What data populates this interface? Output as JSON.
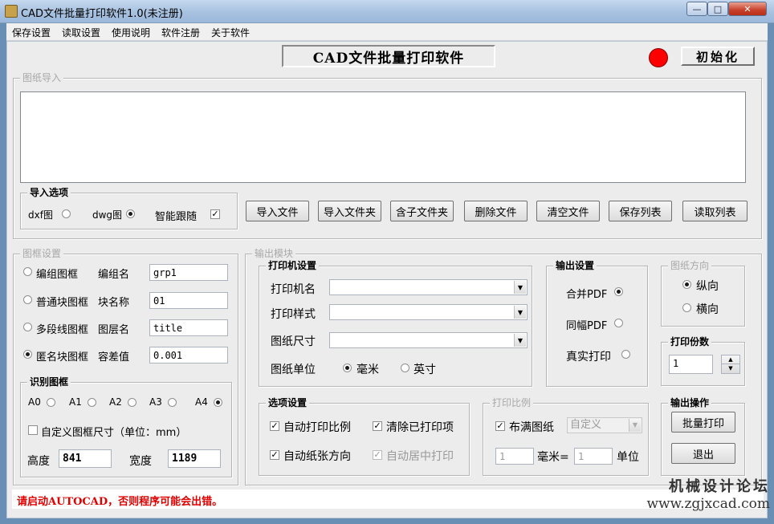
{
  "window": {
    "title": "CAD文件批量打印软件1.0(未注册)",
    "min": "—",
    "max": "□",
    "close": "✕"
  },
  "menu": [
    "保存设置",
    "读取设置",
    "使用说明",
    "软件注册",
    "关于软件"
  ],
  "banner": "CAD文件批量打印软件",
  "init_button": "初始化",
  "colors": {
    "status_led": "#ff0000",
    "warning": "#e00000"
  },
  "import": {
    "group": "图纸导入",
    "options_group": "导入选项",
    "dxf": "dxf图",
    "dwg": "dwg图",
    "smart": "智能跟随",
    "buttons": [
      "导入文件",
      "导入文件夹",
      "含子文件夹",
      "删除文件",
      "清空文件",
      "保存列表",
      "读取列表"
    ]
  },
  "frame": {
    "group": "图框设置",
    "rows": [
      {
        "opt": "编组图框",
        "label": "编组名",
        "value": "grp1"
      },
      {
        "opt": "普通块图框",
        "label": "块名称",
        "value": "01"
      },
      {
        "opt": "多段线图框",
        "label": "图层名",
        "value": "title"
      },
      {
        "opt": "匿名块图框",
        "label": "容差值",
        "value": "0.001"
      }
    ],
    "detect_group": "识别图框",
    "sizes": [
      "A0",
      "A1",
      "A2",
      "A3",
      "A4"
    ],
    "custom": "自定义图框尺寸（单位：mm）",
    "height_label": "高度",
    "height": "841",
    "width_label": "宽度",
    "width": "1189"
  },
  "output": {
    "group": "输出模块",
    "printer_group": "打印机设置",
    "printer_name": "打印机名",
    "print_style": "打印样式",
    "paper_size": "图纸尺寸",
    "paper_unit": "图纸单位",
    "mm": "毫米",
    "inch": "英寸",
    "out_group": "输出设置",
    "merge_pdf": "合并PDF",
    "same_pdf": "同幅PDF",
    "real_print": "真实打印",
    "orient_group": "图纸方向",
    "portrait": "纵向",
    "landscape": "横向",
    "copies_group": "打印份数",
    "copies": "1",
    "opt_group": "选项设置",
    "auto_scale": "自动打印比例",
    "clear_printed": "清除已打印项",
    "auto_orient": "自动纸张方向",
    "auto_center": "自动居中打印",
    "scale_group": "打印比例",
    "fill": "布满图纸",
    "custom": "自定义",
    "scale_mm": "1",
    "mm_eq": "毫米=",
    "scale_unit": "1",
    "unit": "单位",
    "ops_group": "输出操作",
    "batch": "批量打印",
    "exit": "退出"
  },
  "status": "请启动AUTOCAD，否则程序可能会出错。",
  "watermark": {
    "line1": "机械设计论坛",
    "line2": "www.zgjxcad.com"
  }
}
